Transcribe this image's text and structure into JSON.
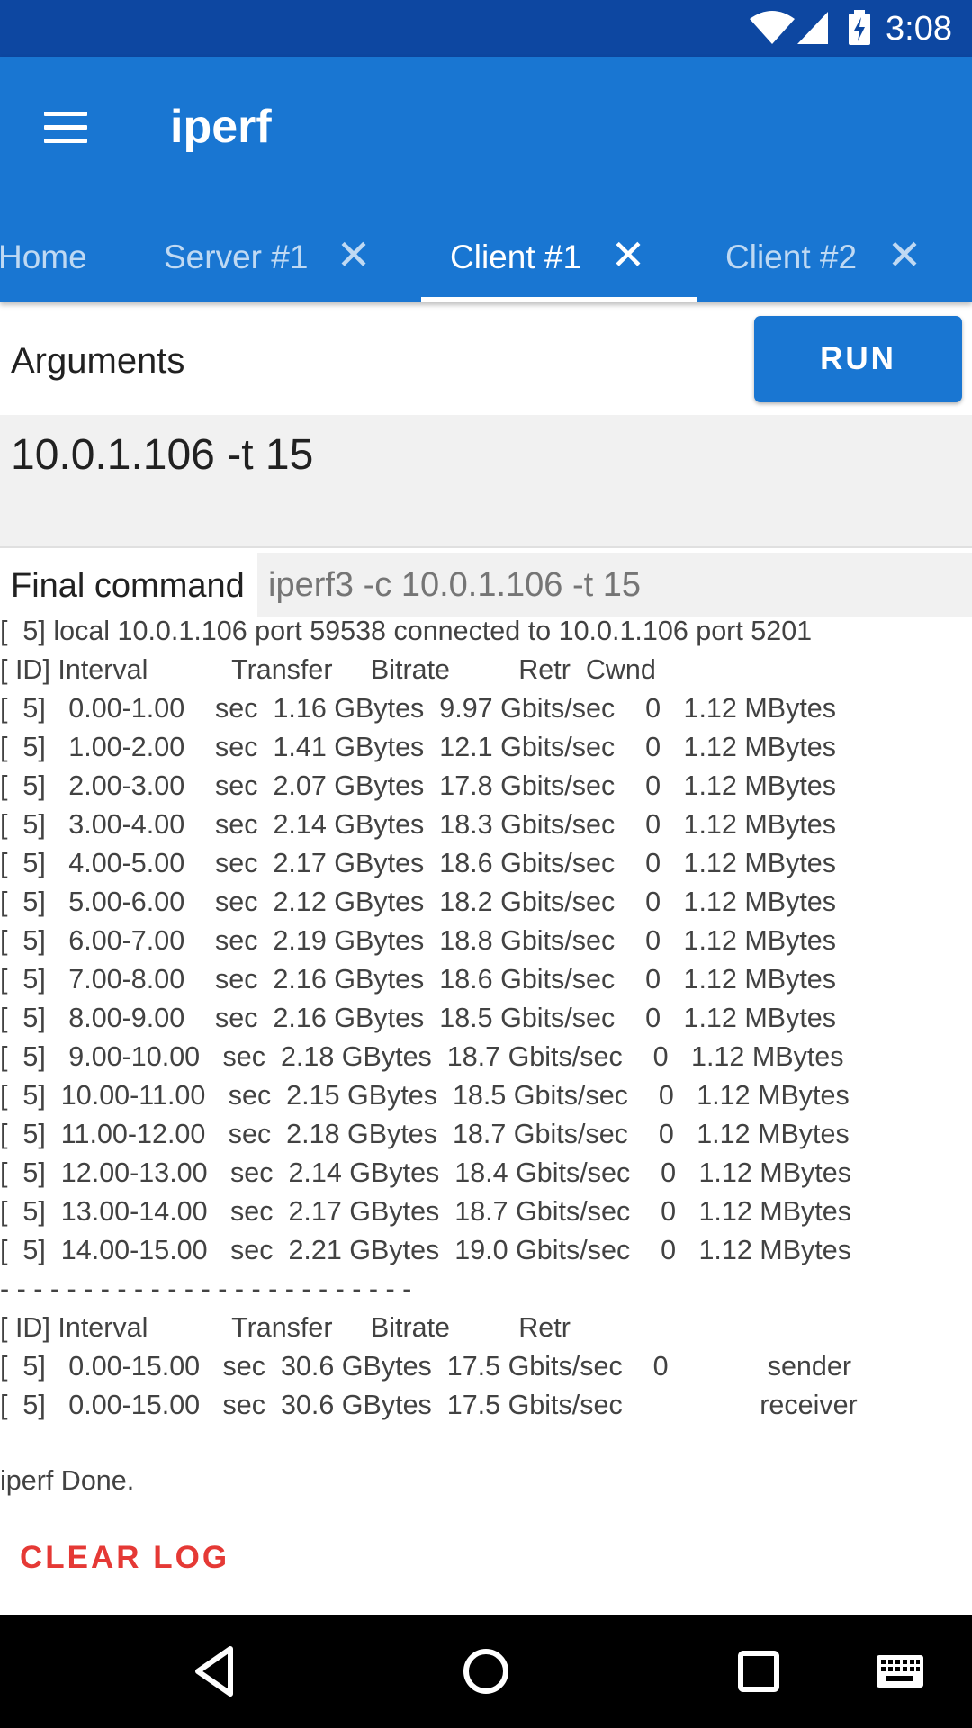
{
  "status_bar": {
    "time": "3:08",
    "icons": [
      "wifi-icon",
      "cell-signal-icon",
      "battery-charging-icon"
    ]
  },
  "app_bar": {
    "menu_icon": "hamburger-menu-icon",
    "title": "iperf"
  },
  "tabs": [
    {
      "label": "Home",
      "closable": false,
      "active": false
    },
    {
      "label": "Server #1",
      "closable": true,
      "active": false
    },
    {
      "label": "Client #1",
      "closable": true,
      "active": true
    },
    {
      "label": "Client #2",
      "closable": true,
      "active": false
    }
  ],
  "close_glyph": "✕",
  "form": {
    "arguments_label": "Arguments",
    "run_label": "RUN",
    "arguments_value": "10.0.1.106 -t 15",
    "final_command_label": "Final command",
    "final_command_value": "iperf3 -c 10.0.1.106 -t 15"
  },
  "log_lines": [
    "[  5] local 10.0.1.106 port 59538 connected to 10.0.1.106 port 5201",
    "[ ID] Interval           Transfer     Bitrate         Retr  Cwnd",
    "[  5]   0.00-1.00    sec  1.16 GBytes  9.97 Gbits/sec    0   1.12 MBytes",
    "[  5]   1.00-2.00    sec  1.41 GBytes  12.1 Gbits/sec    0   1.12 MBytes",
    "[  5]   2.00-3.00    sec  2.07 GBytes  17.8 Gbits/sec    0   1.12 MBytes",
    "[  5]   3.00-4.00    sec  2.14 GBytes  18.3 Gbits/sec    0   1.12 MBytes",
    "[  5]   4.00-5.00    sec  2.17 GBytes  18.6 Gbits/sec    0   1.12 MBytes",
    "[  5]   5.00-6.00    sec  2.12 GBytes  18.2 Gbits/sec    0   1.12 MBytes",
    "[  5]   6.00-7.00    sec  2.19 GBytes  18.8 Gbits/sec    0   1.12 MBytes",
    "[  5]   7.00-8.00    sec  2.16 GBytes  18.6 Gbits/sec    0   1.12 MBytes",
    "[  5]   8.00-9.00    sec  2.16 GBytes  18.5 Gbits/sec    0   1.12 MBytes",
    "[  5]   9.00-10.00   sec  2.18 GBytes  18.7 Gbits/sec    0   1.12 MBytes",
    "[  5]  10.00-11.00   sec  2.15 GBytes  18.5 Gbits/sec    0   1.12 MBytes",
    "[  5]  11.00-12.00   sec  2.18 GBytes  18.7 Gbits/sec    0   1.12 MBytes",
    "[  5]  12.00-13.00   sec  2.14 GBytes  18.4 Gbits/sec    0   1.12 MBytes",
    "[  5]  13.00-14.00   sec  2.17 GBytes  18.7 Gbits/sec    0   1.12 MBytes",
    "[  5]  14.00-15.00   sec  2.21 GBytes  19.0 Gbits/sec    0   1.12 MBytes",
    "- - - - - - - - - - - - - - - - - - - - - - - - -",
    "[ ID] Interval           Transfer     Bitrate         Retr",
    "[  5]   0.00-15.00   sec  30.6 GBytes  17.5 Gbits/sec    0             sender",
    "[  5]   0.00-15.00   sec  30.6 GBytes  17.5 Gbits/sec                  receiver"
  ],
  "log_done": "iperf Done.",
  "clear_log_label": "CLEAR LOG",
  "nav_bar": [
    "back-icon",
    "home-icon",
    "recents-icon",
    "keyboard-icon"
  ],
  "colors": {
    "status_bar": "#0d47a1",
    "app_bar": "#1976d2",
    "accent_button": "#1976d2",
    "clear_log": "#e53935"
  }
}
